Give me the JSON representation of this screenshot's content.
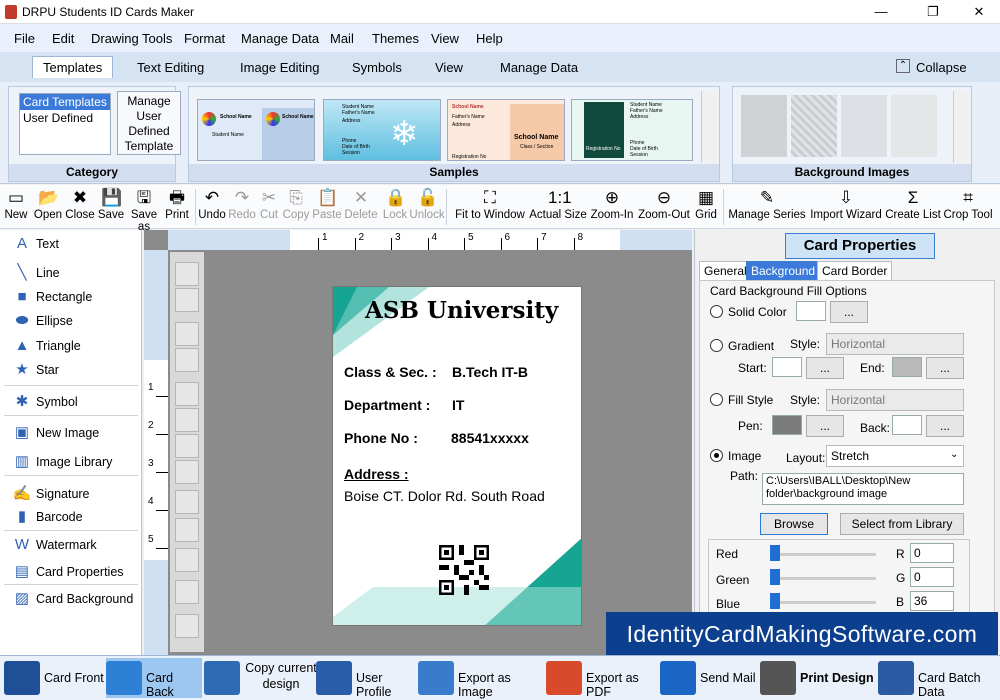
{
  "window": {
    "title": "DRPU Students ID Cards Maker",
    "minimize": "—",
    "maximize": "❐",
    "close": "✕"
  },
  "menu": [
    "File",
    "Edit",
    "Drawing Tools",
    "Format",
    "Manage Data",
    "Mail",
    "Themes",
    "View",
    "Help"
  ],
  "ribbon_tabs": [
    "Templates",
    "Text Editing",
    "Image Editing",
    "Symbols",
    "View",
    "Manage Data"
  ],
  "collapse_label": "Collapse",
  "category": {
    "items": [
      "Card Templates",
      "User Defined"
    ],
    "manage_button": "Manage User Defined Template",
    "label": "Category"
  },
  "samples": {
    "label": "Samples",
    "texts": [
      "School Name",
      "Student Name",
      "School Name",
      "Student Name",
      "Father's Name",
      "Address",
      "Phone",
      "Date of Birth",
      "Session",
      "School Name",
      "Father's Name",
      "Address",
      "Registration No",
      "School Name",
      "Class / Section",
      "Student Name",
      "Father's Name",
      "Address",
      "Phone",
      "Date of Birth",
      "Session",
      "Registration No"
    ]
  },
  "background_images": {
    "label": "Background Images"
  },
  "toolbar": [
    "New",
    "Open",
    "Close",
    "Save",
    "Save as",
    "Print",
    "Undo",
    "Redo",
    "Cut",
    "Copy",
    "Paste",
    "Delete",
    "Lock",
    "Unlock",
    "Fit to Window",
    "Actual Size",
    "Zoom-In",
    "Zoom-Out",
    "Grid",
    "Manage Series",
    "Import Wizard",
    "Create List",
    "Crop Tool"
  ],
  "toolbar_icons": {
    "New": "▭",
    "Open": "📂",
    "Close": "✖",
    "Save": "💾",
    "Save as": "🖫",
    "Print": "🖶",
    "Undo": "↶",
    "Redo": "↷",
    "Cut": "✂",
    "Copy": "⎘",
    "Paste": "📋",
    "Delete": "✕",
    "Lock": "🔒",
    "Unlock": "🔓",
    "Fit to Window": "⛶",
    "Actual Size": "1:1",
    "Zoom-In": "⊕",
    "Zoom-Out": "⊖",
    "Grid": "▦",
    "Manage Series": "✎",
    "Import Wizard": "⇩",
    "Create List": "Σ",
    "Crop Tool": "⌗"
  },
  "left_tools": [
    {
      "label": "Text",
      "icon": "A"
    },
    {
      "label": "Line",
      "icon": "╲"
    },
    {
      "label": "Rectangle",
      "icon": "■"
    },
    {
      "label": "Ellipse",
      "icon": "⬬"
    },
    {
      "label": "Triangle",
      "icon": "▲"
    },
    {
      "label": "Star",
      "icon": "★"
    },
    {
      "label": "Symbol",
      "icon": "✱"
    },
    {
      "label": "New Image",
      "icon": "▣"
    },
    {
      "label": "Image Library",
      "icon": "▥"
    },
    {
      "label": "Signature",
      "icon": "✍"
    },
    {
      "label": "Barcode",
      "icon": "▮"
    },
    {
      "label": "Watermark",
      "icon": "W"
    },
    {
      "label": "Card Properties",
      "icon": "▤"
    },
    {
      "label": "Card Background",
      "icon": "▨"
    }
  ],
  "ruler": {
    "h": [
      "1",
      "2",
      "3",
      "4",
      "5",
      "6",
      "7",
      "8"
    ],
    "v": [
      "1",
      "2",
      "3",
      "4",
      "5"
    ]
  },
  "card": {
    "title": "ASB University",
    "class_label": "Class & Sec. :",
    "class_value": "B.Tech IT-B",
    "dept_label": "Department :",
    "dept_value": "IT",
    "phone_label": "Phone No :",
    "phone_value": "88541xxxxx",
    "address_label": "Address :",
    "address_value": "Boise CT. Dolor Rd. South Road",
    "accent": "#1a9e8f"
  },
  "properties": {
    "title": "Card Properties",
    "tabs": [
      "General",
      "Background",
      "Card Border"
    ],
    "group_label": "Card Background Fill Options",
    "solid_color": "Solid Color",
    "gradient": "Gradient",
    "style_label": "Style:",
    "gradient_style": "Horizontal",
    "start_label": "Start:",
    "end_label": "End:",
    "fill_style": "Fill Style",
    "fill_style_value": "Horizontal",
    "pen_label": "Pen:",
    "back_label": "Back:",
    "image": "Image",
    "layout_label": "Layout:",
    "layout_value": "Stretch",
    "path_label": "Path:",
    "path_value": "C:\\Users\\IBALL\\Desktop\\New folder\\background image",
    "browse": "Browse",
    "select_library": "Select from Library",
    "ellipsis": "...",
    "red_label": "Red",
    "green_label": "Green",
    "blue_label": "Blue",
    "r": "R",
    "g": "G",
    "b": "B",
    "red_value": "0",
    "green_value": "0",
    "blue_value": "36"
  },
  "bottom": [
    "Card Front",
    "Card Back",
    "Copy current design",
    "User Profile",
    "Export as Image",
    "Export as PDF",
    "Send Mail",
    "Print Design",
    "Card Batch Data"
  ],
  "watermark": "IdentityCardMakingSoftware.com"
}
